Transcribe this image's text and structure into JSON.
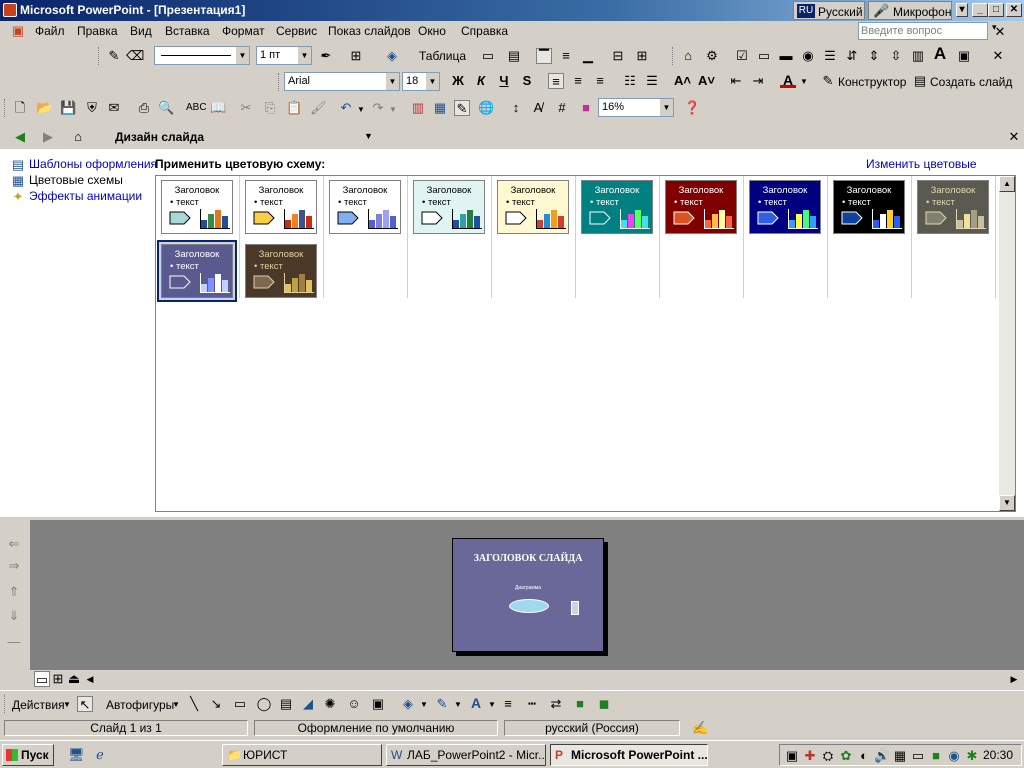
{
  "window": {
    "title": "Microsoft PowerPoint - [Презентация1]",
    "lang_code": "RU",
    "lang_name": "Русский",
    "mic": "Микрофон"
  },
  "menu": [
    "Файл",
    "Правка",
    "Вид",
    "Вставка",
    "Формат",
    "Сервис",
    "Показ слайдов",
    "Окно",
    "Справка"
  ],
  "ask_placeholder": "Введите вопрос",
  "toolbar_table": {
    "line_width": "1 пт",
    "table_label": "Таблица"
  },
  "toolbar_format": {
    "font": "Arial",
    "size": "18",
    "bold": "Ж",
    "italic": "К",
    "underline": "Ч",
    "shadow": "S",
    "designer": "Конструктор",
    "new_slide": "Создать слайд"
  },
  "toolbar_standard": {
    "zoom": "16%"
  },
  "taskpane": {
    "title": "Дизайн слайда",
    "links": [
      "Шаблоны оформления",
      "Цветовые схемы",
      "Эффекты анимации"
    ],
    "apply_label": "Применить цветовую схему:",
    "edit_link": "Изменить цветовые схемы...",
    "scheme_heading": "Заголовок",
    "scheme_bullet": "• текст",
    "schemes": [
      {
        "bg": "#ffffff",
        "fg": "#000000",
        "arrow": "#a8d8d8",
        "bars": [
          "#1f4e9a",
          "#3c8a3c",
          "#e07820"
        ]
      },
      {
        "bg": "#ffffff",
        "fg": "#000000",
        "arrow": "#f8d048",
        "bars": [
          "#c83010",
          "#f08020",
          "#405090"
        ]
      },
      {
        "bg": "#ffffff",
        "fg": "#000000",
        "arrow": "#80b0f0",
        "bars": [
          "#5060d0",
          "#8080e0",
          "#a0a0f0"
        ]
      },
      {
        "bg": "#e0f4f4",
        "fg": "#000000",
        "arrow": "#ffffff",
        "bars": [
          "#2050a0",
          "#30a0a0",
          "#208040"
        ]
      },
      {
        "bg": "#fff8d0",
        "fg": "#000000",
        "arrow": "#ffffff",
        "bars": [
          "#d04030",
          "#2090d0",
          "#f0a020"
        ]
      },
      {
        "bg": "#008080",
        "fg": "#ffffff",
        "arrow": "#008080",
        "bars": [
          "#40e0f0",
          "#f040f0",
          "#60ff60"
        ]
      },
      {
        "bg": "#800000",
        "fg": "#ffffff",
        "arrow": "#e05020",
        "bars": [
          "#ff6040",
          "#ffc040",
          "#ffffa0"
        ]
      },
      {
        "bg": "#000080",
        "fg": "#ffffff",
        "arrow": "#3060e0",
        "bars": [
          "#30a0ff",
          "#ffff40",
          "#40ff80"
        ]
      },
      {
        "bg": "#000000",
        "fg": "#ffffff",
        "arrow": "#1040a0",
        "bars": [
          "#2060ff",
          "#ffffff",
          "#ffd020"
        ]
      },
      {
        "bg": "#5a5a50",
        "fg": "#e0d8b0",
        "arrow": "#808070",
        "bars": [
          "#c8c0a0",
          "#f0e0a0",
          "#a0a080"
        ]
      },
      {
        "bg": "#5a5a90",
        "fg": "#ffffff",
        "arrow": "#5a5a90",
        "bars": [
          "#c0d0ff",
          "#8090ff",
          "#ffffff"
        ]
      },
      {
        "bg": "#4a3828",
        "fg": "#e0d0a0",
        "arrow": "#806850",
        "bars": [
          "#e0c060",
          "#c0a040",
          "#a08040"
        ]
      }
    ]
  },
  "slide": {
    "title": "ЗАГОЛОВОК СЛАЙДА",
    "diagram_label": "Диаграмма"
  },
  "drawing": {
    "actions": "Действия",
    "autoshapes": "Автофигуры"
  },
  "status": {
    "slide": "Слайд 1 из 1",
    "design": "Оформление по умолчанию",
    "language": "русский (Россия)"
  },
  "taskbar": {
    "start": "Пуск",
    "tasks": [
      "ЮРИСТ",
      "ЛАБ_PowerPoint2 - Micr...",
      "Microsoft PowerPoint ..."
    ],
    "clock": "20:30"
  }
}
